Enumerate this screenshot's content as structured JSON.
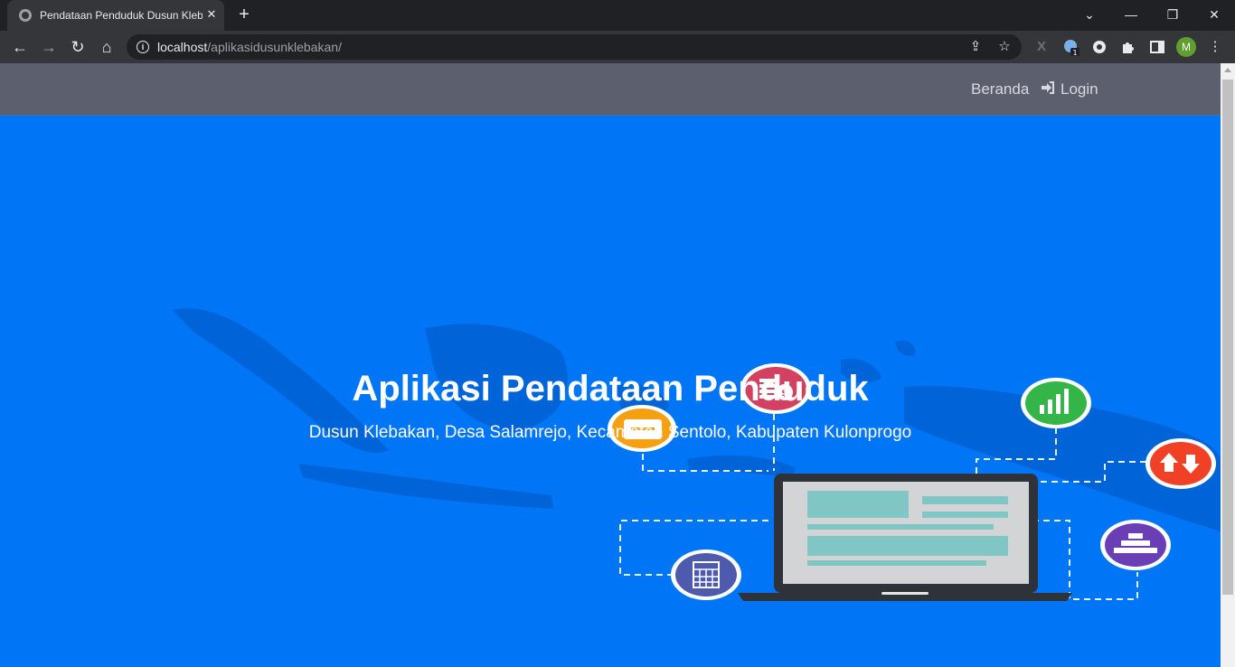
{
  "browser": {
    "tab_title": "Pendataan Penduduk Dusun Klebakan",
    "tab_close": "✕",
    "new_tab": "+",
    "url_host": "localhost",
    "url_path": "/aplikasidusunklebakan/",
    "avatar_letter": "M",
    "extension_badge": "1"
  },
  "navbar": {
    "beranda": "Beranda",
    "login": "Login"
  },
  "hero": {
    "title": "Aplikasi Pendataan Penduduk",
    "subtitle": "Dusun Klebakan, Desa Salamrejo, Kecamatan Sentolo, Kabupaten Kulonprogo"
  },
  "colors": {
    "page_bg": "#0076f6",
    "navbar_bg": "#5c5f6e",
    "orange": "#f4a011",
    "red": "#d44060",
    "green": "#34b548",
    "redorange": "#f04126",
    "purple": "#6a3fb5",
    "indigo": "#4d5aad"
  },
  "icons": [
    "globe-icon",
    "back-icon",
    "forward-icon",
    "reload-icon",
    "home-icon",
    "info-icon",
    "share-icon",
    "star-icon",
    "puzzle-icon",
    "sidepanel-icon",
    "menu-icon",
    "login-icon"
  ]
}
